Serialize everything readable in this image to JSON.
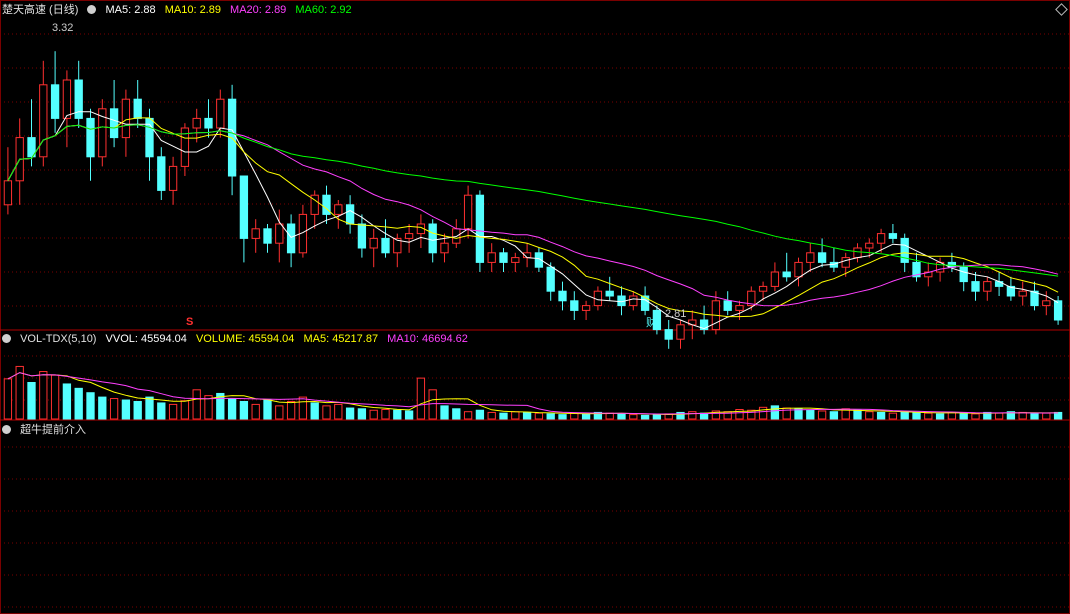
{
  "main_panel": {
    "title": "楚天高速 (日线)",
    "ma_labels": [
      {
        "text": "MA5: 2.88",
        "color": "#ffffff"
      },
      {
        "text": "MA10: 2.89",
        "color": "#ffff00"
      },
      {
        "text": "MA20: 2.89",
        "color": "#ff40ff"
      },
      {
        "text": "MA60: 2.92",
        "color": "#00ff00"
      }
    ],
    "high_label": "3.32",
    "low_label": "2.81",
    "marker_s": "S",
    "marker_cai": "财"
  },
  "volume_panel": {
    "title": "VOL-TDX(5,10)",
    "labels": [
      {
        "text": "VVOL: 45594.04",
        "color": "#ffffff"
      },
      {
        "text": "VOLUME: 45594.04",
        "color": "#ffff00"
      },
      {
        "text": "MA5: 45217.87",
        "color": "#ffff00"
      },
      {
        "text": "MA10: 46694.62",
        "color": "#ff40ff"
      }
    ]
  },
  "signal_panel": {
    "title": "超牛提前介入"
  },
  "colors": {
    "up": "#ff3030",
    "down": "#54ffff",
    "ma5": "#ffffff",
    "ma10": "#ffff00",
    "ma20": "#ff40ff",
    "ma60": "#00ff00",
    "signal": "#ffff00",
    "grid": "#7a0000"
  },
  "chart_data": {
    "type": "candlestick",
    "price_range": [
      2.76,
      3.36
    ],
    "volume_range": [
      0,
      100
    ],
    "signal_range": [
      0,
      100
    ],
    "candles": [
      [
        3.0,
        3.12,
        2.98,
        3.05
      ],
      [
        3.05,
        3.18,
        3.0,
        3.14
      ],
      [
        3.14,
        3.22,
        3.08,
        3.1
      ],
      [
        3.1,
        3.3,
        3.08,
        3.25
      ],
      [
        3.25,
        3.32,
        3.15,
        3.18
      ],
      [
        3.18,
        3.28,
        3.12,
        3.26
      ],
      [
        3.26,
        3.3,
        3.16,
        3.18
      ],
      [
        3.18,
        3.2,
        3.05,
        3.1
      ],
      [
        3.1,
        3.22,
        3.08,
        3.2
      ],
      [
        3.2,
        3.26,
        3.12,
        3.14
      ],
      [
        3.14,
        3.24,
        3.1,
        3.22
      ],
      [
        3.22,
        3.26,
        3.16,
        3.18
      ],
      [
        3.18,
        3.2,
        3.05,
        3.1
      ],
      [
        3.1,
        3.12,
        3.01,
        3.03
      ],
      [
        3.03,
        3.1,
        3.0,
        3.08
      ],
      [
        3.08,
        3.17,
        3.06,
        3.16
      ],
      [
        3.16,
        3.2,
        3.13,
        3.18
      ],
      [
        3.18,
        3.22,
        3.14,
        3.16
      ],
      [
        3.16,
        3.24,
        3.14,
        3.22
      ],
      [
        3.22,
        3.25,
        3.02,
        3.06
      ],
      [
        3.06,
        3.05,
        2.88,
        2.93
      ],
      [
        2.93,
        2.97,
        2.9,
        2.95
      ],
      [
        2.95,
        2.96,
        2.9,
        2.92
      ],
      [
        2.92,
        2.99,
        2.88,
        2.96
      ],
      [
        2.96,
        2.98,
        2.87,
        2.9
      ],
      [
        2.9,
        3.0,
        2.89,
        2.98
      ],
      [
        2.98,
        3.03,
        2.95,
        3.02
      ],
      [
        3.02,
        3.04,
        2.96,
        2.98
      ],
      [
        2.98,
        3.01,
        2.95,
        3.0
      ],
      [
        3.0,
        3.02,
        2.94,
        2.96
      ],
      [
        2.96,
        2.98,
        2.89,
        2.91
      ],
      [
        2.91,
        2.95,
        2.87,
        2.93
      ],
      [
        2.93,
        2.97,
        2.89,
        2.9
      ],
      [
        2.9,
        2.94,
        2.87,
        2.93
      ],
      [
        2.93,
        2.96,
        2.9,
        2.94
      ],
      [
        2.94,
        2.98,
        2.91,
        2.96
      ],
      [
        2.96,
        2.97,
        2.88,
        2.9
      ],
      [
        2.9,
        2.94,
        2.88,
        2.92
      ],
      [
        2.92,
        2.97,
        2.91,
        2.95
      ],
      [
        2.95,
        3.04,
        2.93,
        3.02
      ],
      [
        3.02,
        3.03,
        2.86,
        2.88
      ],
      [
        2.88,
        2.92,
        2.86,
        2.9
      ],
      [
        2.9,
        2.91,
        2.86,
        2.88
      ],
      [
        2.88,
        2.9,
        2.86,
        2.89
      ],
      [
        2.89,
        2.92,
        2.87,
        2.9
      ],
      [
        2.9,
        2.91,
        2.86,
        2.87
      ],
      [
        2.87,
        2.88,
        2.8,
        2.82
      ],
      [
        2.82,
        2.84,
        2.78,
        2.8
      ],
      [
        2.8,
        2.82,
        2.76,
        2.78
      ],
      [
        2.78,
        2.8,
        2.76,
        2.79
      ],
      [
        2.79,
        2.83,
        2.78,
        2.82
      ],
      [
        2.82,
        2.85,
        2.8,
        2.81
      ],
      [
        2.81,
        2.83,
        2.77,
        2.79
      ],
      [
        2.79,
        2.82,
        2.78,
        2.81
      ],
      [
        2.81,
        2.83,
        2.77,
        2.78
      ],
      [
        2.78,
        2.79,
        2.73,
        2.74
      ],
      [
        2.74,
        2.76,
        2.7,
        2.72
      ],
      [
        2.72,
        2.76,
        2.7,
        2.75
      ],
      [
        2.75,
        2.78,
        2.72,
        2.76
      ],
      [
        2.76,
        2.79,
        2.73,
        2.74
      ],
      [
        2.74,
        2.82,
        2.73,
        2.8
      ],
      [
        2.8,
        2.82,
        2.77,
        2.78
      ],
      [
        2.78,
        2.8,
        2.76,
        2.79
      ],
      [
        2.79,
        2.83,
        2.78,
        2.82
      ],
      [
        2.82,
        2.84,
        2.8,
        2.83
      ],
      [
        2.83,
        2.88,
        2.82,
        2.86
      ],
      [
        2.86,
        2.9,
        2.84,
        2.85
      ],
      [
        2.85,
        2.89,
        2.83,
        2.88
      ],
      [
        2.88,
        2.92,
        2.86,
        2.9
      ],
      [
        2.9,
        2.93,
        2.87,
        2.88
      ],
      [
        2.88,
        2.91,
        2.86,
        2.87
      ],
      [
        2.87,
        2.9,
        2.85,
        2.89
      ],
      [
        2.89,
        2.92,
        2.88,
        2.91
      ],
      [
        2.91,
        2.93,
        2.89,
        2.92
      ],
      [
        2.92,
        2.95,
        2.9,
        2.94
      ],
      [
        2.94,
        2.96,
        2.92,
        2.93
      ],
      [
        2.93,
        2.94,
        2.86,
        2.88
      ],
      [
        2.88,
        2.9,
        2.84,
        2.85
      ],
      [
        2.85,
        2.88,
        2.83,
        2.86
      ],
      [
        2.86,
        2.89,
        2.84,
        2.88
      ],
      [
        2.88,
        2.9,
        2.86,
        2.87
      ],
      [
        2.87,
        2.88,
        2.82,
        2.84
      ],
      [
        2.84,
        2.86,
        2.8,
        2.82
      ],
      [
        2.82,
        2.85,
        2.8,
        2.84
      ],
      [
        2.84,
        2.86,
        2.81,
        2.83
      ],
      [
        2.83,
        2.85,
        2.8,
        2.81
      ],
      [
        2.81,
        2.84,
        2.79,
        2.82
      ],
      [
        2.82,
        2.84,
        2.78,
        2.79
      ],
      [
        2.79,
        2.82,
        2.77,
        2.8
      ],
      [
        2.8,
        2.81,
        2.75,
        2.76
      ]
    ],
    "ma5": [],
    "ma10": [],
    "ma20": [],
    "ma60": [],
    "volume": [
      [
        55,
        "up"
      ],
      [
        72,
        "up"
      ],
      [
        50,
        "down"
      ],
      [
        65,
        "up"
      ],
      [
        60,
        "up"
      ],
      [
        48,
        "down"
      ],
      [
        42,
        "down"
      ],
      [
        36,
        "down"
      ],
      [
        30,
        "down"
      ],
      [
        28,
        "up"
      ],
      [
        26,
        "down"
      ],
      [
        24,
        "down"
      ],
      [
        30,
        "down"
      ],
      [
        22,
        "down"
      ],
      [
        20,
        "up"
      ],
      [
        25,
        "up"
      ],
      [
        40,
        "up"
      ],
      [
        32,
        "up"
      ],
      [
        35,
        "down"
      ],
      [
        28,
        "down"
      ],
      [
        24,
        "down"
      ],
      [
        20,
        "up"
      ],
      [
        26,
        "down"
      ],
      [
        18,
        "up"
      ],
      [
        24,
        "up"
      ],
      [
        30,
        "up"
      ],
      [
        22,
        "down"
      ],
      [
        18,
        "up"
      ],
      [
        20,
        "up"
      ],
      [
        15,
        "down"
      ],
      [
        14,
        "down"
      ],
      [
        12,
        "up"
      ],
      [
        13,
        "up"
      ],
      [
        12,
        "down"
      ],
      [
        11,
        "down"
      ],
      [
        56,
        "up"
      ],
      [
        40,
        "up"
      ],
      [
        18,
        "down"
      ],
      [
        14,
        "down"
      ],
      [
        10,
        "up"
      ],
      [
        12,
        "down"
      ],
      [
        9,
        "up"
      ],
      [
        8,
        "down"
      ],
      [
        10,
        "up"
      ],
      [
        9,
        "down"
      ],
      [
        8,
        "up"
      ],
      [
        7,
        "down"
      ],
      [
        6,
        "down"
      ],
      [
        8,
        "up"
      ],
      [
        7,
        "down"
      ],
      [
        9,
        "down"
      ],
      [
        8,
        "up"
      ],
      [
        7,
        "down"
      ],
      [
        6,
        "up"
      ],
      [
        5,
        "down"
      ],
      [
        6,
        "down"
      ],
      [
        7,
        "up"
      ],
      [
        9,
        "down"
      ],
      [
        10,
        "up"
      ],
      [
        8,
        "down"
      ],
      [
        11,
        "up"
      ],
      [
        10,
        "up"
      ],
      [
        13,
        "up"
      ],
      [
        12,
        "up"
      ],
      [
        16,
        "up"
      ],
      [
        18,
        "down"
      ],
      [
        15,
        "up"
      ],
      [
        14,
        "down"
      ],
      [
        12,
        "down"
      ],
      [
        11,
        "up"
      ],
      [
        10,
        "down"
      ],
      [
        14,
        "up"
      ],
      [
        12,
        "down"
      ],
      [
        10,
        "up"
      ],
      [
        9,
        "down"
      ],
      [
        8,
        "up"
      ],
      [
        10,
        "down"
      ],
      [
        9,
        "down"
      ],
      [
        8,
        "up"
      ],
      [
        7,
        "down"
      ],
      [
        9,
        "up"
      ],
      [
        8,
        "down"
      ],
      [
        7,
        "up"
      ],
      [
        9,
        "down"
      ],
      [
        8,
        "up"
      ],
      [
        10,
        "down"
      ],
      [
        9,
        "up"
      ],
      [
        7,
        "down"
      ],
      [
        8,
        "up"
      ],
      [
        9,
        "down"
      ]
    ],
    "signals": [
      {
        "index": 0,
        "value": 0
      }
    ]
  }
}
